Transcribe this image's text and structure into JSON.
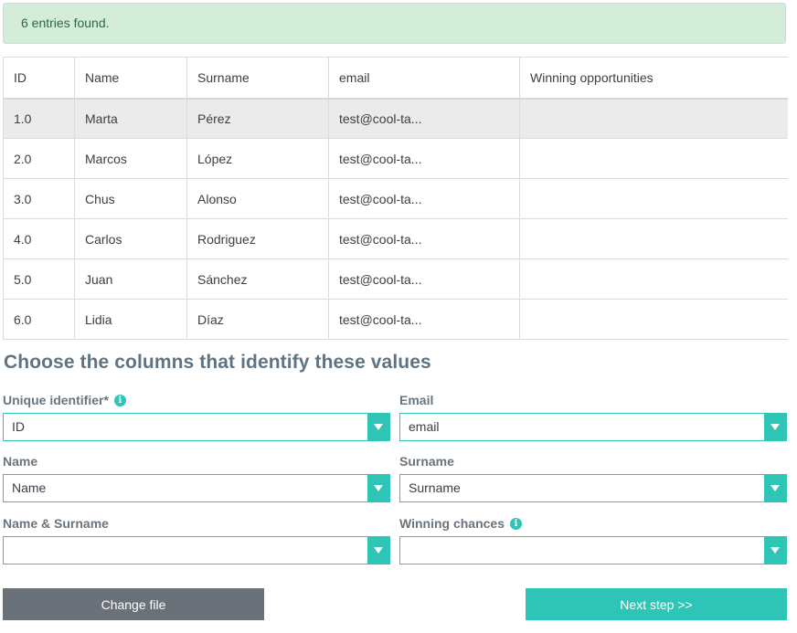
{
  "alert": {
    "text": "6 entries found."
  },
  "table": {
    "headers": [
      "ID",
      "Name",
      "Surname",
      "email",
      "Winning opportunities"
    ],
    "rows": [
      [
        "1.0",
        "Marta",
        "Pérez",
        "test@cool-ta...",
        ""
      ],
      [
        "2.0",
        "Marcos",
        "López",
        "test@cool-ta...",
        ""
      ],
      [
        "3.0",
        "Chus",
        "Alonso",
        "test@cool-ta...",
        ""
      ],
      [
        "4.0",
        "Carlos",
        "Rodriguez",
        "test@cool-ta...",
        ""
      ],
      [
        "5.0",
        "Juan",
        "Sánchez",
        "test@cool-ta...",
        ""
      ],
      [
        "6.0",
        "Lidia",
        "Díaz",
        "test@cool-ta...",
        ""
      ]
    ]
  },
  "form": {
    "title": "Choose the columns that identify these values",
    "fields": [
      {
        "label": "Unique identifier*",
        "value": "ID",
        "info": true
      },
      {
        "label": "Email",
        "value": "email",
        "info": false
      },
      {
        "label": "Name",
        "value": "Name",
        "info": false
      },
      {
        "label": "Surname",
        "value": "Surname",
        "info": false
      },
      {
        "label": "Name & Surname",
        "value": "",
        "info": false
      },
      {
        "label": "Winning chances",
        "value": "",
        "info": true
      }
    ],
    "info_glyph": "i"
  },
  "buttons": {
    "change_file": "Change file",
    "next_step": "Next step >>"
  },
  "colors": {
    "accent": "#2ec4b6",
    "alert_bg": "#d4eddb",
    "grey_button": "#6b7178",
    "title": "#5f7482"
  }
}
